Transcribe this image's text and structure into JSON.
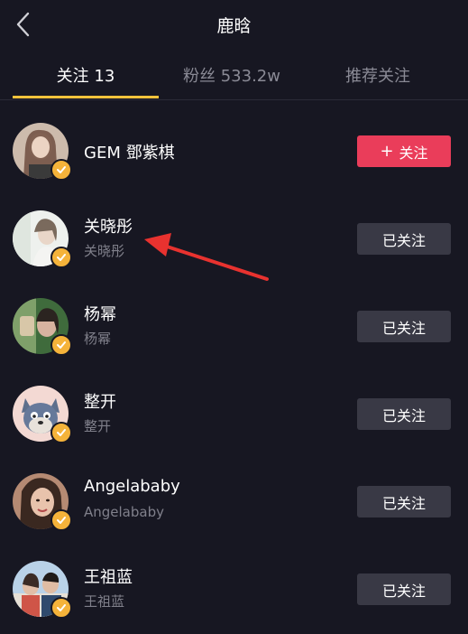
{
  "header": {
    "title": "鹿晗"
  },
  "tabs": [
    {
      "label": "关注 13",
      "active": true
    },
    {
      "label": "粉丝 533.2w",
      "active": false
    },
    {
      "label": "推荐关注",
      "active": false
    }
  ],
  "users": [
    {
      "name": "GEM 鄧紫棋",
      "sub": "",
      "button": "+ 关注",
      "button_text": "关注",
      "followed": false,
      "verified": true,
      "avatar_colors": [
        "#d9c7b7",
        "#7a5b4b"
      ]
    },
    {
      "name": "关晓彤",
      "sub": "关晓彤",
      "button_text": "已关注",
      "followed": true,
      "verified": true,
      "avatar_colors": [
        "#eef0ee",
        "#b8c2bc"
      ]
    },
    {
      "name": "杨幂",
      "sub": "杨幂",
      "button_text": "已关注",
      "followed": true,
      "verified": true,
      "avatar_colors": [
        "#3b6a3c",
        "#c9a48f"
      ]
    },
    {
      "name": "整开",
      "sub": "整开",
      "button_text": "已关注",
      "followed": true,
      "verified": true,
      "avatar_colors": [
        "#f2d6d0",
        "#5a6b86"
      ]
    },
    {
      "name": "Angelababy",
      "sub": "Angelababy",
      "button_text": "已关注",
      "followed": true,
      "verified": true,
      "avatar_colors": [
        "#c8967f",
        "#3c2a23"
      ]
    },
    {
      "name": "王祖蓝",
      "sub": "王祖蓝",
      "button_text": "已关注",
      "followed": true,
      "verified": true,
      "avatar_colors": [
        "#a9c8e6",
        "#d25b4e"
      ]
    }
  ],
  "colors": {
    "background": "#171722",
    "accent_yellow": "#f6c33b",
    "follow_red": "#ea3d5a",
    "followed_gray": "#393945",
    "annotation_red": "#e8322f"
  },
  "icons": {
    "back": "chevron-left-icon",
    "verified": "check-badge-icon",
    "plus": "plus-icon",
    "annotation": "red-arrow-annotation"
  }
}
